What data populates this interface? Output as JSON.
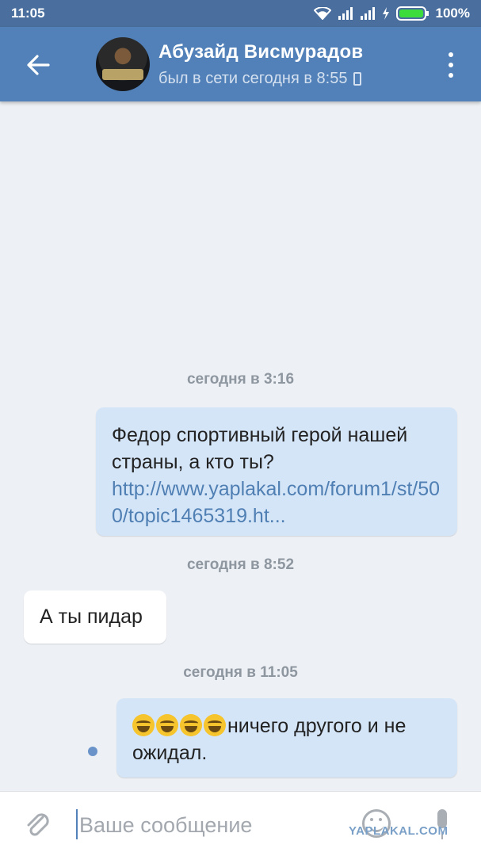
{
  "status_bar": {
    "time": "11:05",
    "battery": "100%",
    "icons": [
      "wifi-icon",
      "signal-icon",
      "signal-icon",
      "charging-icon",
      "battery-icon"
    ]
  },
  "toolbar": {
    "back_icon": "arrow-left-icon",
    "contact_name": "Абузайд Висмурадов",
    "contact_status": "был в сети сегодня в 8:55",
    "status_icon": "mobile-phone-icon",
    "more_icon": "more-vertical-icon"
  },
  "messages": [
    {
      "type": "date",
      "text": "сегодня в 3:16"
    },
    {
      "type": "outgoing",
      "text": "Федор спортивный герой нашей страны, а кто ты?",
      "link": "http://www.yaplakal.com/forum1/st/500/topic1465319.ht..."
    },
    {
      "type": "date",
      "text": "сегодня в 8:52"
    },
    {
      "type": "incoming",
      "text": "А ты пидар"
    },
    {
      "type": "date",
      "text": "сегодня в 11:05"
    },
    {
      "type": "outgoing",
      "emoji": [
        "tears-of-joy-emoji",
        "tears-of-joy-emoji",
        "tears-of-joy-emoji",
        "tears-of-joy-emoji"
      ],
      "text": "ничего другого и не ожидал.",
      "unread": true
    }
  ],
  "composer": {
    "placeholder": "Ваше сообщение",
    "attach_icon": "paperclip-icon",
    "emoji_icon": "smiley-icon",
    "mic_icon": "microphone-icon"
  },
  "watermark": "YAPLAKAL.COM",
  "colors": {
    "toolbar": "#5181b8",
    "status_bar": "#4a6f9e",
    "background": "#edf0f4",
    "outgoing_bubble": "#d5e5f8",
    "incoming_bubble": "#ffffff",
    "link": "#4f7fb3"
  }
}
